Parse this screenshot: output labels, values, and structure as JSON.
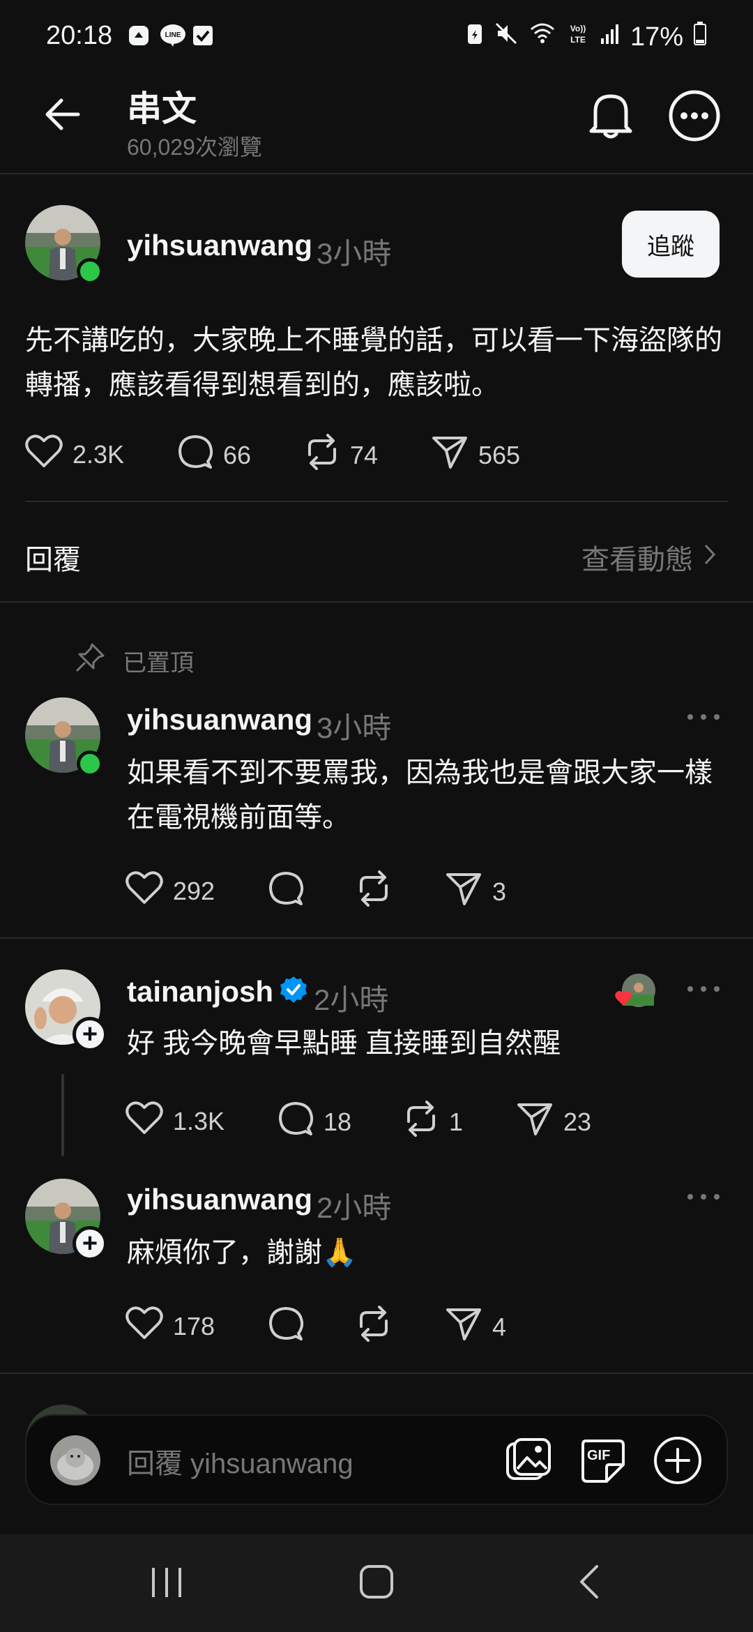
{
  "status_bar": {
    "time": "20:18",
    "battery": "17%",
    "left_icons": [
      "notification-icon",
      "line-app-icon",
      "checkbox-icon"
    ],
    "right_icons": [
      "battery-saver-icon",
      "mute-icon",
      "wifi-icon",
      "volte-icon",
      "signal-icon",
      "battery-icon"
    ]
  },
  "header": {
    "title": "串文",
    "views": "60,029次瀏覽"
  },
  "main_post": {
    "username": "yihsuanwang",
    "time": "3小時",
    "follow_label": "追蹤",
    "text": "先不講吃的，大家晚上不睡覺的話，可以看一下海盜隊的轉播，應該看得到想看到的，應該啦。",
    "likes": "2.3K",
    "comments": "66",
    "reposts": "74",
    "shares": "565"
  },
  "replies_bar": {
    "label": "回覆",
    "activity_link": "查看動態"
  },
  "pinned": {
    "label": "已置頂",
    "username": "yihsuanwang",
    "time": "3小時",
    "text": "如果看不到不要罵我，因為我也是會跟大家一樣在電視機前面等。",
    "likes": "292",
    "comments": "",
    "reposts": "",
    "shares": "3"
  },
  "reply1": {
    "username": "tainanjosh",
    "verified": true,
    "time": "2小時",
    "text": "好 我今晚會早點睡 直接睡到自然醒",
    "likes": "1.3K",
    "comments": "18",
    "reposts": "1",
    "shares": "23"
  },
  "reply2": {
    "username": "yihsuanwang",
    "time": "2小時",
    "text": "麻煩你了，謝謝🙏",
    "likes": "178",
    "comments": "",
    "reposts": "",
    "shares": "4"
  },
  "composer": {
    "placeholder": "回覆 yihsuanwang",
    "gif_label": "GIF"
  },
  "colors": {
    "background": "#101010",
    "text": "#f3f5f7",
    "secondary": "#777777",
    "online": "#2cc64a",
    "verified": "#0095f6",
    "heart": "#ff3040"
  }
}
